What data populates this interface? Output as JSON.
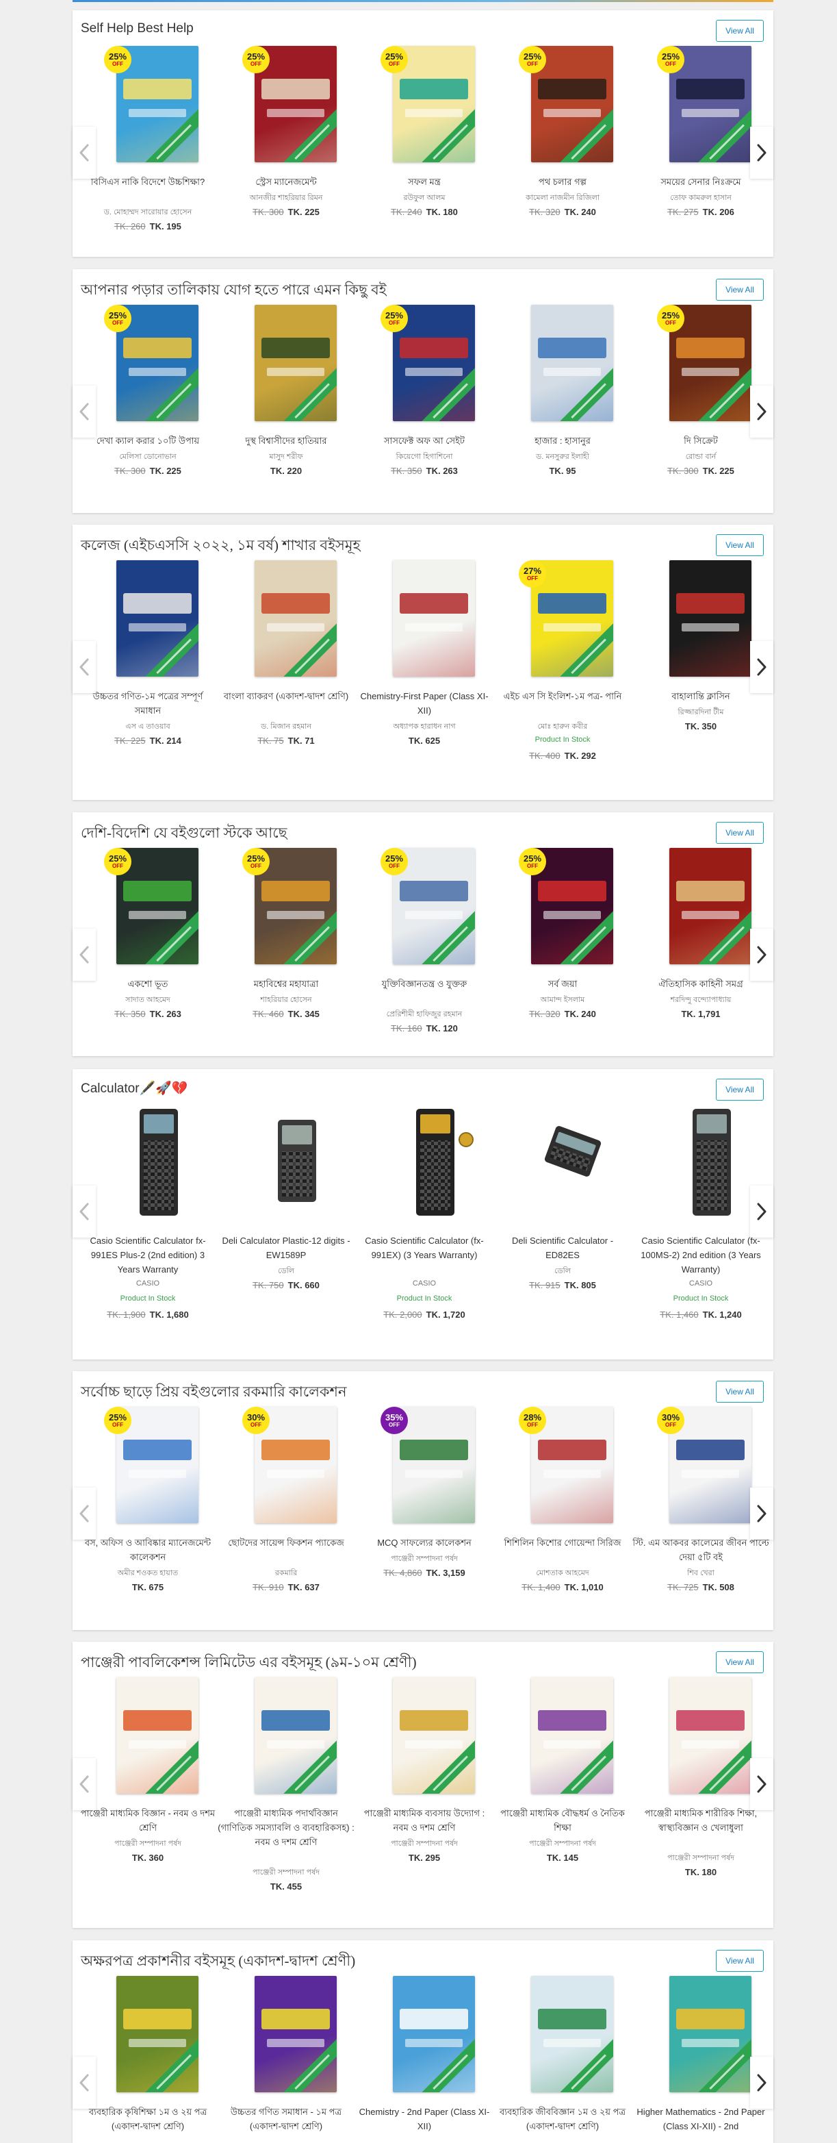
{
  "view_all_label": "View All",
  "sections": [
    {
      "title": "Self Help Best Help",
      "items": [
        {
          "name": "বিসিএস নাকি বিদেশে উচ্চশিক্ষা?",
          "author": "ড. মোহাম্মদ সারোয়ার হোসেন",
          "old_price": "TK. 260",
          "new_price": "TK. 195",
          "discount": "25%",
          "color": "#3ea3d9",
          "accent": "#f7e36a"
        },
        {
          "name": "স্ট্রেস ম্যানেজমেন্ট",
          "author": "আনজীর শাহরিয়ার রিমন",
          "old_price": "TK. 300",
          "new_price": "TK. 225",
          "discount": "25%",
          "color": "#9d1b24",
          "accent": "#e8d8c0"
        },
        {
          "name": "সফল মন্ত্র",
          "author": "রউফুল আলম",
          "old_price": "TK. 240",
          "new_price": "TK. 180",
          "discount": "25%",
          "color": "#f3e7a2",
          "accent": "#1ea38e"
        },
        {
          "name": "পথ চলার গল্প",
          "author": "কামেলা নাজমীন রিজিলা",
          "old_price": "TK. 320",
          "new_price": "TK. 240",
          "discount": "25%",
          "color": "#b4432a",
          "accent": "#2c1d16"
        },
        {
          "name": "সময়ের সেনার নিঃক্রমে",
          "author": "তোফ কামরুল হাসান",
          "old_price": "TK. 275",
          "new_price": "TK. 206",
          "discount": "25%",
          "color": "#5b5a9a",
          "accent": "#1a1c3a"
        }
      ]
    },
    {
      "title": "আপনার পড়ার তালিকায় যোগ হতে পারে এমন কিছু বই",
      "items": [
        {
          "name": "দেখা ক্যাল করার ১০টি উপায়",
          "author": "মেলিসা ডোনোভান",
          "old_price": "TK. 300",
          "new_price": "TK. 225",
          "discount": "25%",
          "color": "#2473b7",
          "accent": "#f2c73a"
        },
        {
          "name": "দুস্থ বিশ্বাসীদের হাতিয়ার",
          "author": "মাসুদ শরীফ",
          "old_price": "",
          "new_price": "TK. 220",
          "discount": "",
          "color": "#c9a43b",
          "accent": "#2e4a22"
        },
        {
          "name": "সাসফেক্ট অফ আ সেইট",
          "author": "কিয়েগো হিগাশিনো",
          "old_price": "TK. 350",
          "new_price": "TK. 263",
          "discount": "25%",
          "color": "#1e3f85",
          "accent": "#c92a2a"
        },
        {
          "name": "হাজার : হাসানুর",
          "author": "ড. মনসুরুর ইলাহী",
          "old_price": "",
          "new_price": "TK. 95",
          "discount": "",
          "color": "#d4dde6",
          "accent": "#3b74b8"
        },
        {
          "name": "দি সিক্রেট",
          "author": "রোন্ডা বার্ন",
          "old_price": "TK. 300",
          "new_price": "TK. 225",
          "discount": "25%",
          "color": "#6b2a16",
          "accent": "#e08a2a"
        }
      ]
    },
    {
      "title": "কলেজ (এইচএসসি ২০২২, ১ম বর্ষ) শাখার বইসমূহ",
      "items": [
        {
          "name": "উচ্চতর গণিত-১ম পত্রের সম্পূর্ণ সমাধান",
          "author": "এস এ তাওয়াব",
          "stock": "",
          "old_price": "TK. 225",
          "new_price": "TK. 214",
          "discount": "",
          "color": "#1d3f86",
          "accent": "#e8e8e8"
        },
        {
          "name": "বাংলা ব্যাকরণ (একাদশ-দ্বাদশ শ্রেণি)",
          "author": "ড. মিজান রহমান",
          "stock": "",
          "old_price": "TK. 75",
          "new_price": "TK. 71",
          "discount": "",
          "color": "#e0d3b8",
          "accent": "#c84a2a"
        },
        {
          "name": "Chemistry-First Paper (Class XI-XII)",
          "author": "অধ্যাপক হারাধন নাগ",
          "stock": "",
          "old_price": "",
          "new_price": "TK. 625",
          "discount": "",
          "color": "#f2f2ef",
          "accent": "#b02a2a"
        },
        {
          "name": "এইচ এস সি ইংলিশ-১ম পত্র- পানি",
          "author": "মোঃ হারুন কবীর",
          "stock": "Product In Stock",
          "old_price": "TK. 400",
          "new_price": "TK. 292",
          "discount": "27%",
          "color": "#f4e21f",
          "accent": "#1f5fb5"
        },
        {
          "name": "বাহালান্তি ক্লাসিন",
          "author": "রিজ্জারদিনা টীম",
          "stock": "",
          "old_price": "",
          "new_price": "TK. 350",
          "discount": "",
          "color": "#1b1b1b",
          "accent": "#c8302a"
        }
      ]
    },
    {
      "title": "দেশি-বিদেশি যে বইগুলো স্টকে আছে",
      "items": [
        {
          "name": "একশো ভূত",
          "author": "সাদাত আহমেদ",
          "old_price": "TK. 350",
          "new_price": "TK. 263",
          "discount": "25%",
          "color": "#24302b",
          "accent": "#3fae3a"
        },
        {
          "name": "মহাবিশ্বের মহাযাত্রা",
          "author": "শাহরিয়ার হোসেন",
          "old_price": "TK. 460",
          "new_price": "TK. 345",
          "discount": "25%",
          "color": "#5e4a3a",
          "accent": "#e09a2a"
        },
        {
          "name": "যুক্তিবিজ্ঞানতন্ত্র ও যুক্তরু",
          "author": "প্রেরিশীমী হাফিজুর রহমান",
          "old_price": "TK. 160",
          "new_price": "TK. 120",
          "discount": "25%",
          "color": "#e9ecef",
          "accent": "#4a6fa8"
        },
        {
          "name": "সর্ব জয়া",
          "author": "আমান্দ ইসলাম",
          "old_price": "TK. 320",
          "new_price": "TK. 240",
          "discount": "25%",
          "color": "#3a0c2a",
          "accent": "#d42a2a"
        },
        {
          "name": "ঐতিহাসিক কাহিনী সমগ্র",
          "author": "শরদিন্দু বন্দ্যোপাধ্যায়",
          "old_price": "",
          "new_price": "TK. 1,791",
          "discount": "",
          "color": "#9a1c17",
          "accent": "#e3c07a"
        }
      ]
    },
    {
      "title": "Calculator🖋️🚀💔",
      "items": [
        {
          "name": "Casio Scientific Calculator fx-991ES Plus-2 (2nd edition) 3 Years Warranty",
          "author": "CASIO",
          "stock": "Product In Stock",
          "old_price": "TK. 1,900",
          "new_price": "TK. 1,680",
          "discount": "",
          "color": "#2b2b2b",
          "accent": "#7aa0b0"
        },
        {
          "name": "Deli Calculator Plastic-12 digits - EW1589P",
          "author": "ডেলি",
          "stock": "",
          "old_price": "TK. 750",
          "new_price": "TK. 660",
          "discount": "",
          "color": "#3a3a3a",
          "accent": "#9aa6a0"
        },
        {
          "name": "Casio Scientific Calculator (fx-991EX) (3 Years Warranty)",
          "author": "CASIO",
          "stock": "Product In Stock",
          "old_price": "TK. 2,000",
          "new_price": "TK. 1,720",
          "discount": "",
          "color": "#222",
          "accent": "#d4a32a"
        },
        {
          "name": "Deli Scientific Calculator - ED82ES",
          "author": "ডেলি",
          "stock": "",
          "old_price": "TK. 915",
          "new_price": "TK. 805",
          "discount": "",
          "color": "#2e2e2e",
          "accent": "#8aa6a8"
        },
        {
          "name": "Casio Scientific Calculator (fx-100MS-2) 2nd edition (3 Years Warranty)",
          "author": "CASIO",
          "stock": "Product In Stock",
          "old_price": "TK. 1,460",
          "new_price": "TK. 1,240",
          "discount": "",
          "color": "#333",
          "accent": "#8ea0a0"
        }
      ]
    },
    {
      "title": "সর্বোচ্চ ছাড়ে প্রিয় বইগুলোর রকমারি কালেকশন",
      "items": [
        {
          "name": "বস, অফিস ও আবিষ্কার ম্যানেজমেন্ট কালেকশন",
          "author": "অমীর শওকত হায়াত",
          "old_price": "",
          "new_price": "TK. 675",
          "discount": "25%",
          "color": "#f2f4f7",
          "accent": "#3b79c8"
        },
        {
          "name": "ছোটদের সায়েন্স ফিকশন প্যাকেজ",
          "author": "রকমারি",
          "old_price": "TK. 910",
          "new_price": "TK. 637",
          "discount": "30%",
          "color": "#f5f5f5",
          "accent": "#e07a2a"
        },
        {
          "name": "MCQ সাফল্যের কালেকশন",
          "author": "পাঞ্জেরী সম্পাদনা পর্ষদ",
          "old_price": "TK. 4,860",
          "new_price": "TK. 3,159",
          "discount": "35%",
          "color": "#f2f2f2",
          "accent": "#2e7a3a"
        },
        {
          "name": "শিশিলিন কিশোর গোয়েন্দা সিরিজ",
          "author": "মোশতাক আহমেদ",
          "old_price": "TK. 1,400",
          "new_price": "TK. 1,010",
          "discount": "28%",
          "color": "#f4f4f4",
          "accent": "#b02a2a"
        },
        {
          "name": "স্টি. এম আকবর কালেমের জীবন পাল্টে দেয়া ৫টি বই",
          "author": "শিব খেরা",
          "old_price": "TK. 725",
          "new_price": "TK. 508",
          "discount": "30%",
          "color": "#f4f4f4",
          "accent": "#1f3f8a"
        }
      ]
    },
    {
      "title": "পাঞ্জেরী পাবলিকেশন্স লিমিটেড এর বইসমূহ (৯ম-১০ম শ্রেণী)",
      "items": [
        {
          "name": "পাঞ্জেরী মাধ্যমিক বিজ্ঞান - নবম ও দশম শ্রেণি",
          "author": "পাঞ্জেরী সম্পাদনা পর্ষদ",
          "old_price": "",
          "new_price": "TK. 360",
          "discount": "",
          "color": "#f7f3ea",
          "accent": "#e05a2a"
        },
        {
          "name": "পাঞ্জেরী মাধ্যমিক পদার্থবিজ্ঞান (গাণিতিক সমস্যাবলি ও ব্যবহারিকসহ) : নবম ও দশম শ্রেণি",
          "author": "পাঞ্জেরী সম্পাদনা পর্ষদ",
          "old_price": "",
          "new_price": "TK. 455",
          "discount": "",
          "color": "#f7f3ea",
          "accent": "#2a6ab0"
        },
        {
          "name": "পাঞ্জেরী মাধ্যমিক ব্যবসায় উদ্যোগ : নবম ও দশম শ্রেণি",
          "author": "পাঞ্জেরী সম্পাদনা পর্ষদ",
          "old_price": "",
          "new_price": "TK. 295",
          "discount": "",
          "color": "#f7f3ea",
          "accent": "#d4a32a"
        },
        {
          "name": "পাঞ্জেরী মাধ্যমিক বৌদ্ধধর্ম ও নৈতিক শিক্ষা",
          "author": "পাঞ্জেরী সম্পাদনা পর্ষদ",
          "old_price": "",
          "new_price": "TK. 145",
          "discount": "",
          "color": "#f7f3ea",
          "accent": "#7a3a9a"
        },
        {
          "name": "পাঞ্জেরী মাধ্যমিক শারীরিক শিক্ষা, স্বাস্থ্যবিজ্ঞান ও খেলাধুলা",
          "author": "পাঞ্জেরী সম্পাদনা পর্ষদ",
          "old_price": "",
          "new_price": "TK. 180",
          "discount": "",
          "color": "#f7f3ea",
          "accent": "#c83a5a"
        }
      ]
    },
    {
      "title": "অক্ষরপত্র প্রকাশনীর বইসমূহ (একাদশ-দ্বাদশ শ্রেণী)",
      "items": [
        {
          "name": "ব্যবহারিক কৃষিশিক্ষা ১ম ও ২য় পত্র (একাদশ-দ্বাদশ শ্রেণি)",
          "author": "",
          "old_price": "",
          "new_price": "",
          "discount": "",
          "color": "#6a8a2a",
          "accent": "#f2d03a"
        },
        {
          "name": "উচ্চতর গণিত সমাধান - ১ম পত্র (একাদশ-দ্বাদশ শ্রেণি)",
          "author": "",
          "old_price": "",
          "new_price": "",
          "discount": "",
          "color": "#5a2a9a",
          "accent": "#f2e02a"
        },
        {
          "name": "Chemistry - 2nd Paper (Class XI-XII)",
          "author": "",
          "old_price": "",
          "new_price": "",
          "discount": "",
          "color": "#4aa0d8",
          "accent": "#ffffff"
        },
        {
          "name": "ব্যবহারিক জীববিজ্ঞান ১ম ও ২য় পত্র (একাদশ-দ্বাদশ শ্রেণি)",
          "author": "",
          "old_price": "",
          "new_price": "",
          "discount": "",
          "color": "#d8e8ee",
          "accent": "#2a8a4a"
        },
        {
          "name": "Higher Mathematics - 2nd Paper (Class XI-XII) - 2nd",
          "author": "",
          "old_price": "",
          "new_price": "",
          "discount": "",
          "color": "#3ab0a8",
          "accent": "#f4c02a"
        }
      ]
    }
  ]
}
